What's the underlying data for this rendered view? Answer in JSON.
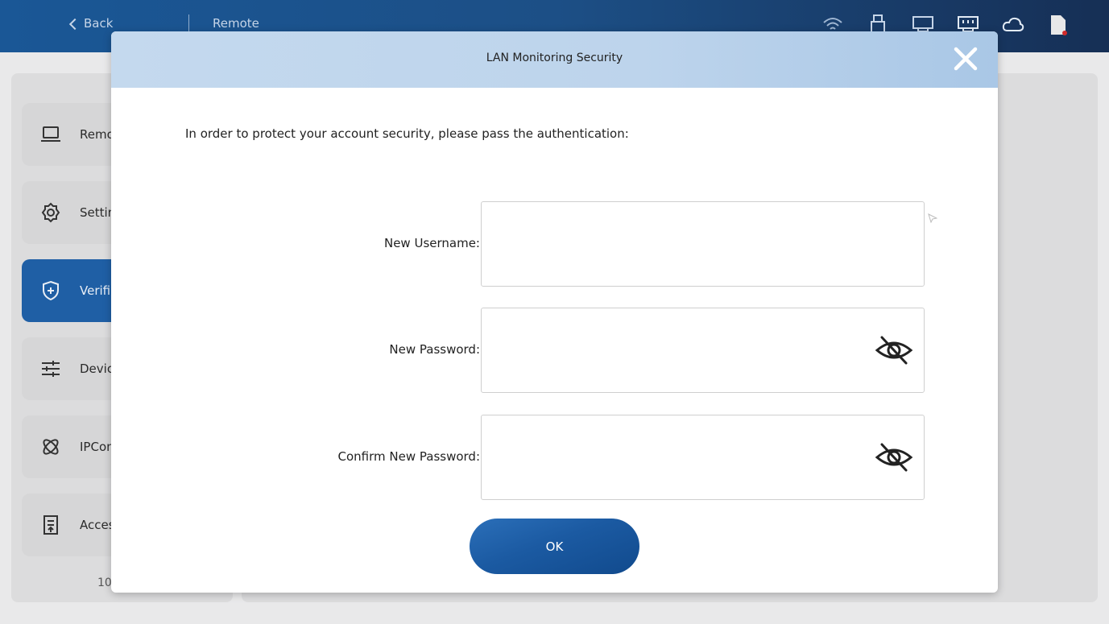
{
  "header": {
    "back_label": "Back",
    "breadcrumb": "Remote",
    "status_icons": [
      "wifi-icon",
      "usb-icon",
      "lan-port-icon",
      "lan-port-connected-icon",
      "cloud-icon",
      "sd-card-icon"
    ]
  },
  "sidebar": {
    "items": [
      {
        "label": "Remo",
        "icon": "laptop-icon",
        "active": false
      },
      {
        "label": "Settin",
        "icon": "gear-icon",
        "active": false
      },
      {
        "label": "Verifi",
        "icon": "shield-icon",
        "active": true
      },
      {
        "label": "Devic",
        "icon": "sliders-icon",
        "active": false
      },
      {
        "label": "IPCon",
        "icon": "network-icon",
        "active": false
      },
      {
        "label": "Acces",
        "icon": "document-icon",
        "active": false
      }
    ],
    "footer": "10"
  },
  "modal": {
    "title": "LAN Monitoring Security",
    "instruction": "In order to protect your account security, please pass the authentication:",
    "fields": {
      "username_label": "New Username:",
      "username_value": "",
      "password_label": "New Password:",
      "password_value": "",
      "confirm_label": "Confirm New Password:",
      "confirm_value": ""
    },
    "ok_label": "OK"
  },
  "colors": {
    "header_blue": "#1c4f86",
    "accent_blue": "#1f5fa5",
    "modal_header": "#bdd4ec"
  }
}
